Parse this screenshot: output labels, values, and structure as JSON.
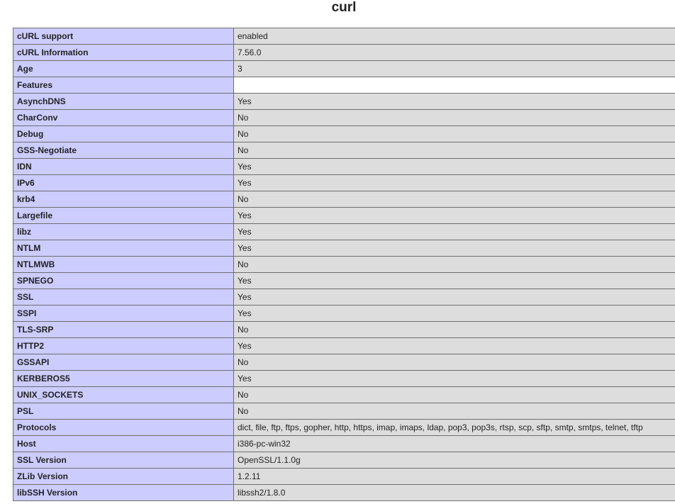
{
  "title": "curl",
  "rows": [
    {
      "key": "cURL support",
      "value": "enabled"
    },
    {
      "key": "cURL Information",
      "value": "7.56.0"
    },
    {
      "key": "Age",
      "value": "3"
    },
    {
      "key": "Features",
      "value": ""
    },
    {
      "key": "AsynchDNS",
      "value": "Yes"
    },
    {
      "key": "CharConv",
      "value": "No"
    },
    {
      "key": "Debug",
      "value": "No"
    },
    {
      "key": "GSS-Negotiate",
      "value": "No"
    },
    {
      "key": "IDN",
      "value": "Yes"
    },
    {
      "key": "IPv6",
      "value": "Yes"
    },
    {
      "key": "krb4",
      "value": "No"
    },
    {
      "key": "Largefile",
      "value": "Yes"
    },
    {
      "key": "libz",
      "value": "Yes"
    },
    {
      "key": "NTLM",
      "value": "Yes"
    },
    {
      "key": "NTLMWB",
      "value": "No"
    },
    {
      "key": "SPNEGO",
      "value": "Yes"
    },
    {
      "key": "SSL",
      "value": "Yes"
    },
    {
      "key": "SSPI",
      "value": "Yes"
    },
    {
      "key": "TLS-SRP",
      "value": "No"
    },
    {
      "key": "HTTP2",
      "value": "Yes"
    },
    {
      "key": "GSSAPI",
      "value": "No"
    },
    {
      "key": "KERBEROS5",
      "value": "Yes"
    },
    {
      "key": "UNIX_SOCKETS",
      "value": "No"
    },
    {
      "key": "PSL",
      "value": "No"
    },
    {
      "key": "Protocols",
      "value": "dict, file, ftp, ftps, gopher, http, https, imap, imaps, ldap, pop3, pop3s, rtsp, scp, sftp, smtp, smtps, telnet, tftp"
    },
    {
      "key": "Host",
      "value": "i386-pc-win32"
    },
    {
      "key": "SSL Version",
      "value": "OpenSSL/1.1.0g"
    },
    {
      "key": "ZLib Version",
      "value": "1.2.11"
    },
    {
      "key": "libSSH Version",
      "value": "libssh2/1.8.0"
    }
  ],
  "colors": {
    "key_bg": "#ccccff",
    "value_bg": "#dddddd",
    "border": "#6e6e6e",
    "text": "#222222"
  }
}
